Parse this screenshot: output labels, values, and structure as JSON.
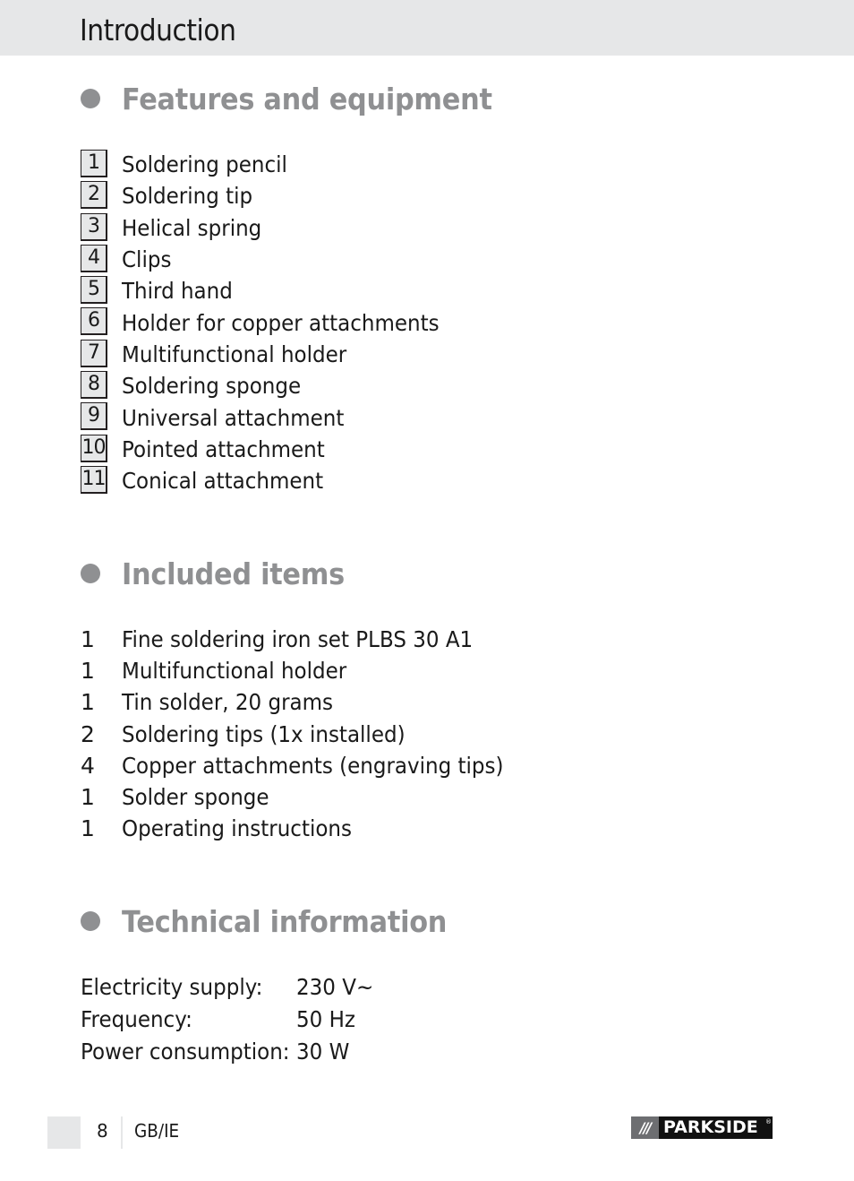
{
  "header": {
    "title": "Introduction",
    "background_color": "#e6e7e8"
  },
  "accent_color": "#8f9092",
  "features": {
    "heading": "Features and equipment",
    "items": [
      {
        "number": "1",
        "label": "Soldering pencil"
      },
      {
        "number": "2",
        "label": "Soldering tip"
      },
      {
        "number": "3",
        "label": "Helical spring"
      },
      {
        "number": "4",
        "label": "Clips"
      },
      {
        "number": "5",
        "label": "Third hand"
      },
      {
        "number": "6",
        "label": "Holder for copper attachments"
      },
      {
        "number": "7",
        "label": "Multifunctional holder"
      },
      {
        "number": "8",
        "label": "Soldering sponge"
      },
      {
        "number": "9",
        "label": "Universal attachment"
      },
      {
        "number": "10",
        "label": "Pointed attachment"
      },
      {
        "number": "11",
        "label": "Conical attachment"
      }
    ]
  },
  "included": {
    "heading": "Included items",
    "items": [
      {
        "qty": "1",
        "label": "Fine soldering iron set PLBS 30 A1"
      },
      {
        "qty": "1",
        "label": "Multifunctional holder"
      },
      {
        "qty": "1",
        "label": "Tin solder, 20 grams"
      },
      {
        "qty": "2",
        "label": "Soldering tips (1x installed)"
      },
      {
        "qty": "4",
        "label": "Copper attachments (engraving tips)"
      },
      {
        "qty": "1",
        "label": "Solder sponge"
      },
      {
        "qty": "1",
        "label": "Operating instructions"
      }
    ]
  },
  "technical": {
    "heading": "Technical information",
    "rows": [
      {
        "label": "Electricity supply:",
        "value": "230 V~"
      },
      {
        "label": "Frequency:",
        "value": "50 Hz"
      },
      {
        "label": "Power consumption:",
        "value": "30 W"
      }
    ]
  },
  "footer": {
    "page_number": "8",
    "locale": "GB/IE",
    "brand": {
      "slashes": "///",
      "name": "PARKSIDE",
      "registered_mark": "®"
    }
  }
}
